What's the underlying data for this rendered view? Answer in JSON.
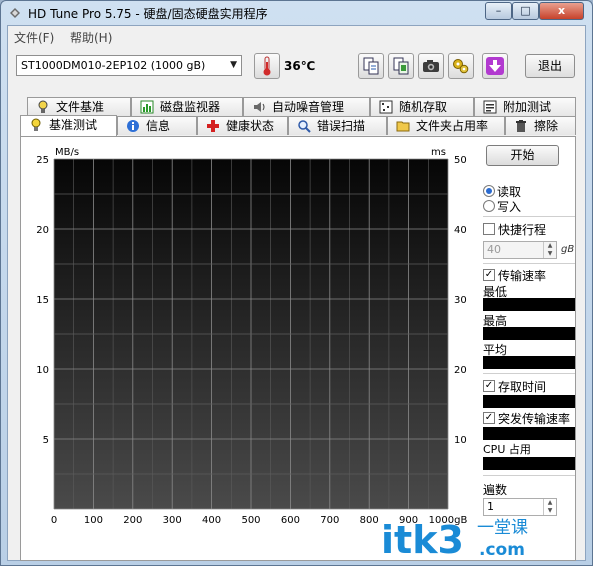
{
  "window": {
    "title": "HD Tune Pro 5.75 - 硬盘/固态硬盘实用程序",
    "buttons": {
      "minimize": "–",
      "maximize": "□",
      "close": "x"
    }
  },
  "menu": {
    "items": [
      {
        "label": "文件(F)"
      },
      {
        "label": "帮助(H)"
      }
    ]
  },
  "toolbar": {
    "drive": "ST1000DM010-2EP102 (1000 gB)",
    "temperature": "36℃",
    "exit_label": "退出",
    "icon_buttons": [
      {
        "icon": "copy-info-icon"
      },
      {
        "icon": "copy-screen-icon"
      },
      {
        "icon": "camera-icon"
      },
      {
        "icon": "options-icon"
      },
      {
        "icon": "download-icon"
      }
    ]
  },
  "tabs_top": [
    {
      "label": "文件基准",
      "icon": "file-benchmark-icon"
    },
    {
      "label": "磁盘监视器",
      "icon": "disk-monitor-icon"
    },
    {
      "label": "自动噪音管理",
      "icon": "speaker-icon"
    },
    {
      "label": "随机存取",
      "icon": "random-access-icon"
    },
    {
      "label": "附加测试",
      "icon": "extra-tests-icon"
    }
  ],
  "tabs_bottom": [
    {
      "label": "基准测试",
      "icon": "bulb-icon",
      "active": true
    },
    {
      "label": "信息",
      "icon": "info-icon"
    },
    {
      "label": "健康状态",
      "icon": "health-cross-icon"
    },
    {
      "label": "错误扫描",
      "icon": "magnifier-icon"
    },
    {
      "label": "文件夹占用率",
      "icon": "folder-icon"
    },
    {
      "label": "擦除",
      "icon": "trash-icon"
    }
  ],
  "chart_data": {
    "type": "line",
    "y_left_unit": "MB/s",
    "y_right_unit": "ms",
    "x_unit": "gB",
    "x_ticks": [
      "0",
      "100",
      "200",
      "300",
      "400",
      "500",
      "600",
      "700",
      "800",
      "900",
      "1000"
    ],
    "y_left_ticks": [
      "25",
      "20",
      "15",
      "10",
      "5"
    ],
    "y_right_ticks": [
      "50",
      "40",
      "30",
      "20",
      "10"
    ],
    "xlim": [
      0,
      1000
    ],
    "ylim_left": [
      0,
      25
    ],
    "ylim_right": [
      0,
      50
    ],
    "grid": true,
    "series": []
  },
  "controls": {
    "start_label": "开始",
    "read_label": "读取",
    "write_label": "写入",
    "mode": "read",
    "short_stroke_label": "快捷行程",
    "short_stroke_checked": false,
    "short_stroke_value": "40",
    "short_stroke_unit": "gB",
    "transfer_rate_label": "传输速率",
    "transfer_rate_checked": true,
    "min_label": "最低",
    "max_label": "最高",
    "avg_label": "平均",
    "access_time_label": "存取时间",
    "access_time_checked": true,
    "burst_rate_label": "突发传输速率",
    "burst_rate_checked": true,
    "cpu_label": "CPU 占用",
    "passes_label": "遍数",
    "passes_value": "1"
  },
  "watermark": {
    "text": "itk3",
    "suffix": ".com",
    "brand": "一堂课",
    "color": "#1a8bd6"
  }
}
